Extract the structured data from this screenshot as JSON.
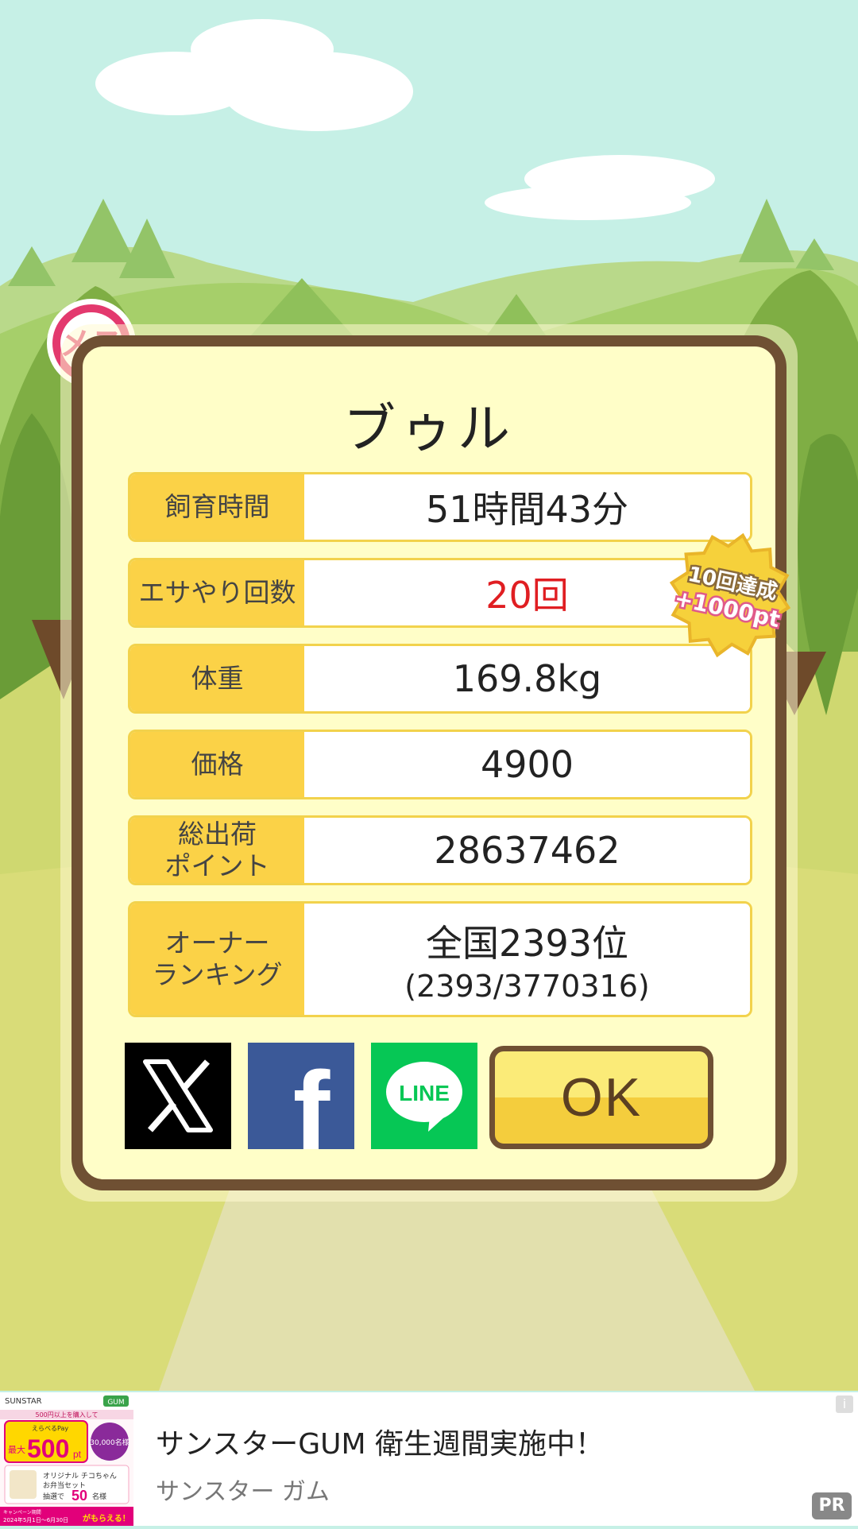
{
  "pig": {
    "sex_label": "メス",
    "name": "ブゥル"
  },
  "stats": [
    {
      "label": "飼育時間",
      "value": "51時間43分"
    },
    {
      "label": "エサやり回数",
      "value": "20回"
    },
    {
      "label": "体重",
      "value": "169.8kg"
    },
    {
      "label": "価格",
      "value": "4900"
    },
    {
      "label": "総出荷\nポイント",
      "value": "28637462"
    },
    {
      "label": "オーナー\nランキング",
      "value": "全国2393位",
      "sub": "(2393/3770316)"
    }
  ],
  "badge": {
    "line1": "10回達成",
    "line2": "+1000pt"
  },
  "buttons": {
    "x": "X",
    "facebook": "f",
    "line": "LINE",
    "ok": "OK"
  },
  "ad": {
    "title": "サンスターGUM 衛生週間実施中！",
    "advertiser": "サンスター ガム",
    "info": "i",
    "pr": "PR",
    "image_texts": [
      "SUNSTAR",
      "GUM",
      "500円以上を購入して",
      "えらべるPay",
      "最大",
      "500",
      "pt",
      "30,000名様",
      "オリジナル チコちゃん",
      "お弁当セット",
      "抽選で",
      "50",
      "名様",
      "キャンペーン期間",
      "2024年5月1日〜6月30日",
      "がもらえる！"
    ]
  },
  "colors": {
    "sky": "#c6f0e6",
    "modal_bg": "#fffec8",
    "modal_border": "#6f5033",
    "label_bg": "#fbd247",
    "highlight_red": "#e01e22",
    "line_green": "#06c755",
    "facebook_blue": "#3b5998"
  }
}
